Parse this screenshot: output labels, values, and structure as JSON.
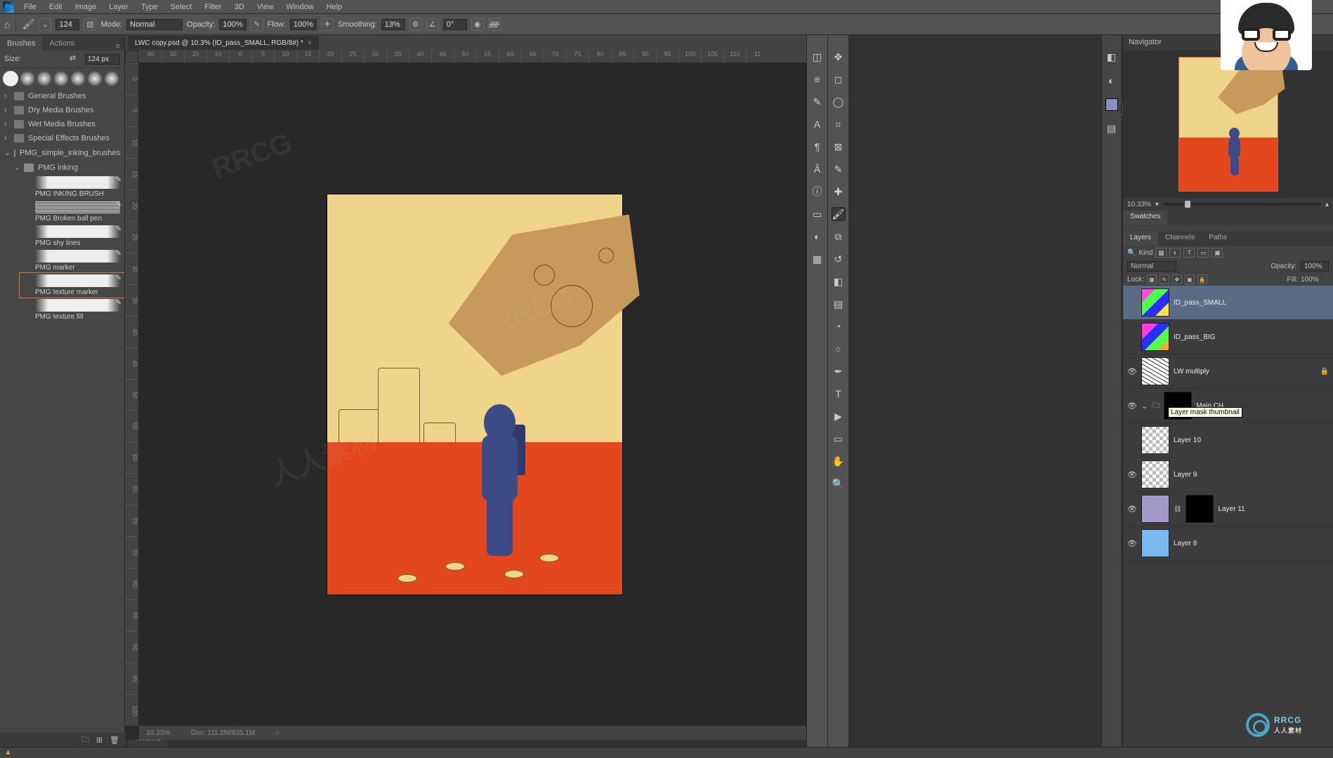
{
  "menu": [
    "File",
    "Edit",
    "Image",
    "Layer",
    "Type",
    "Select",
    "Filter",
    "3D",
    "View",
    "Window",
    "Help"
  ],
  "options": {
    "mode_label": "Mode:",
    "mode_value": "Normal",
    "opacity_label": "Opacity:",
    "opacity_value": "100%",
    "flow_label": "Flow:",
    "flow_value": "100%",
    "smoothing_label": "Smoothing:",
    "smoothing_value": "13%",
    "angle_value": "0°",
    "brush_size": "124"
  },
  "left": {
    "tabs": [
      "Brushes",
      "Actions"
    ],
    "size_label": "Size:",
    "size_value": "124 px",
    "folders": [
      {
        "name": "General Brushes",
        "open": false
      },
      {
        "name": "Dry Media Brushes",
        "open": false
      },
      {
        "name": "Wet Media Brushes",
        "open": false
      },
      {
        "name": "Special Effects Brushes",
        "open": false
      },
      {
        "name": "PMG_simple_inking_brushes",
        "open": true
      }
    ],
    "subfolder": "PMG inking",
    "brushes": [
      {
        "name": "PMG INKING BRUSH"
      },
      {
        "name": "PMG Broken ball pen"
      },
      {
        "name": "PMG shy lines"
      },
      {
        "name": "PMG marker"
      },
      {
        "name": "PMG texture marker",
        "selected": true
      },
      {
        "name": "PMG texture fill"
      }
    ]
  },
  "doc": {
    "tab_title": "LWC copy.psd @ 10.3% (ID_pass_SMALL, RGB/8#) *",
    "zoom": "10.33%",
    "docsize": "Doc: 111.2M/835.1M",
    "ruler_h": [
      "40",
      "30",
      "20",
      "10",
      "0",
      "5",
      "10",
      "15",
      "20",
      "25",
      "30",
      "35",
      "40",
      "45",
      "50",
      "55",
      "60",
      "65",
      "70",
      "75",
      "80",
      "85",
      "90",
      "95",
      "100",
      "105",
      "110",
      "11"
    ],
    "ruler_v": [
      "0",
      "5",
      "10",
      "15",
      "20",
      "25",
      "30",
      "35",
      "40",
      "45",
      "50",
      "55",
      "60",
      "65",
      "70",
      "75",
      "80",
      "85",
      "90",
      "95",
      "100"
    ]
  },
  "timeline_tab": "Timeline",
  "nav": {
    "title": "Navigator",
    "zoom": "10.33%"
  },
  "swatches_tab": "Swatches",
  "layer_tabs": [
    "Layers",
    "Channels",
    "Paths"
  ],
  "layer_filter": {
    "kind_label": "Kind"
  },
  "blend": {
    "mode": "Normal",
    "opacity_label": "Opacity:",
    "opacity": "100%"
  },
  "lock": {
    "label": "Lock:",
    "fill_label": "Fill:",
    "fill": "100%"
  },
  "layers_list": [
    {
      "name": "ID_pass_SMALL",
      "eye": false,
      "thumb": "colorA",
      "selected": true
    },
    {
      "name": "ID_pass_BIG",
      "eye": false,
      "thumb": "colorB"
    },
    {
      "name": "LW multiply",
      "eye": true,
      "thumb": "lines",
      "locked": true
    },
    {
      "name": "Main CH",
      "eye": true,
      "thumb": "mask",
      "group": true,
      "tooltip": "Layer mask thumbnail"
    },
    {
      "name": "Layer 10",
      "eye": false,
      "thumb": "chk"
    },
    {
      "name": "Layer 9",
      "eye": true,
      "thumb": "chk"
    },
    {
      "name": "Layer 11",
      "eye": true,
      "thumb": "solidpurple",
      "mask": true
    },
    {
      "name": "Layer 8",
      "eye": true,
      "thumb": "solidblue"
    }
  ],
  "watermark": "RRCG",
  "watermark_sub": "人人素材",
  "chart_data": null
}
